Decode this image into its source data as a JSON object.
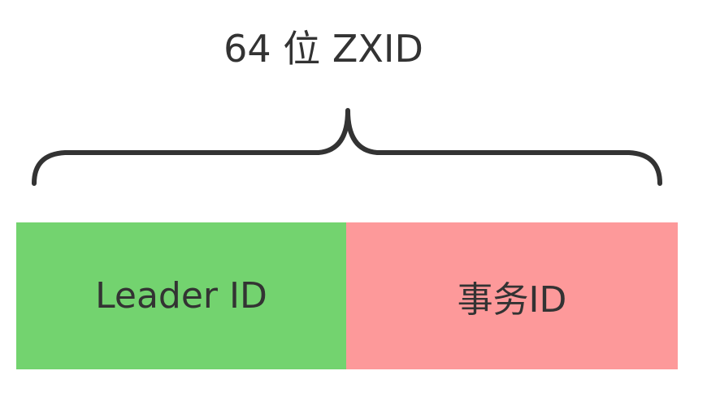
{
  "title": "64 位 ZXID",
  "segments": [
    {
      "label": "Leader ID",
      "color": "#73d36f"
    },
    {
      "label": "事务ID",
      "color": "#fd999a"
    }
  ],
  "brace_color": "#333333"
}
